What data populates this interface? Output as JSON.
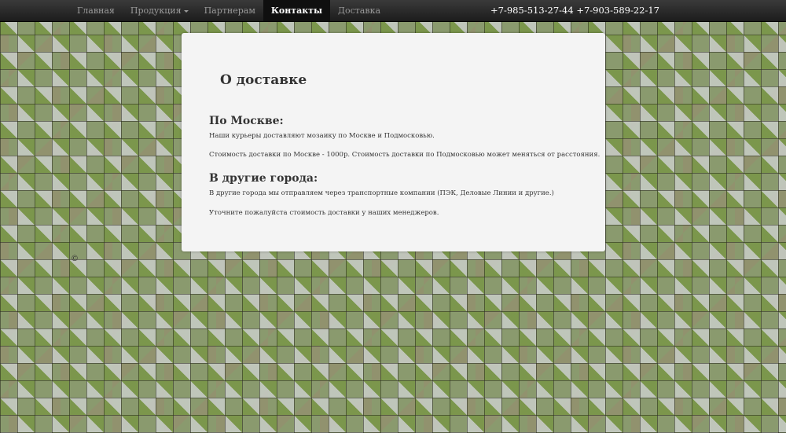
{
  "nav": {
    "items": [
      {
        "label": "Главная",
        "active": false,
        "dropdown": false
      },
      {
        "label": "Продукция",
        "active": false,
        "dropdown": true
      },
      {
        "label": "Партнерам",
        "active": false,
        "dropdown": false
      },
      {
        "label": "Контакты",
        "active": true,
        "dropdown": false
      },
      {
        "label": "Доставка",
        "active": false,
        "dropdown": false
      }
    ],
    "phones": "+7-985-513-27-44 +7-903-589-22-17"
  },
  "content": {
    "title": "О доставке",
    "sections": [
      {
        "heading": "По Москве:",
        "paragraphs": [
          "Наши курьеры доставляют мозаику по Москве и Подмосковью.",
          "Стоимость доставки по Москве - 1000р. Стоимость доставки по Подмосковью может меняться от расстояния."
        ]
      },
      {
        "heading": "В другие города:",
        "paragraphs": [
          "В другие города мы отправляем через транспортные компании (ПЭК, Деловые Линии и другие.)",
          "Уточните пожалуйста стоимость доставки у наших менеджеров."
        ]
      }
    ]
  },
  "footer": {
    "copyright": "©"
  },
  "colors": {
    "navbar": "#1c1c1c",
    "nav_active": "#0f0f0f",
    "card_background": "#f4f4f4",
    "text": "#333333"
  }
}
